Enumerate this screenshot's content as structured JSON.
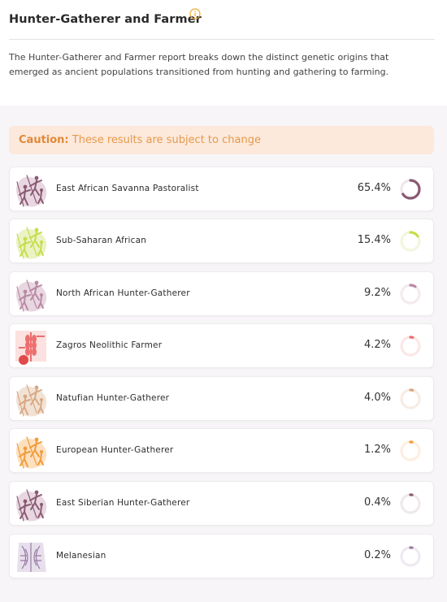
{
  "header": {
    "title": "Hunter-Gatherer and Farmer",
    "description": "The Hunter-Gatherer and Farmer report breaks down the distinct genetic origins that emerged as ancient populations transitioned from hunting and gathering to farming."
  },
  "caution": {
    "label": "Caution:",
    "text": " These results are subject to change"
  },
  "results": [
    {
      "name": "East African Savanna Pastoralist",
      "percent": "65.4%",
      "value": 65.4,
      "color": "#8a5a73",
      "track": "#efe6ec",
      "icon": "hunter-figures-icon",
      "bg": "#e8d7e0"
    },
    {
      "name": "Sub-Saharan African",
      "percent": "15.4%",
      "value": 15.4,
      "color": "#c8dc4a",
      "track": "#f1f6dd",
      "icon": "hunter-figures-icon",
      "bg": "#e9f3c4"
    },
    {
      "name": "North African Hunter-Gatherer",
      "percent": "9.2%",
      "value": 9.2,
      "color": "#b98aa4",
      "track": "#f3ebef",
      "icon": "hunter-figures-icon",
      "bg": "#e8d7e0"
    },
    {
      "name": "Zagros Neolithic Farmer",
      "percent": "4.2%",
      "value": 4.2,
      "color": "#ec6f6f",
      "track": "#fae7e6",
      "icon": "wheat-icon",
      "bg": "#fbe1df"
    },
    {
      "name": "Natufian Hunter-Gatherer",
      "percent": "4.0%",
      "value": 4.0,
      "color": "#d9a883",
      "track": "#f7ece3",
      "icon": "hunter-figures-icon",
      "bg": "#f1e2d4"
    },
    {
      "name": "European Hunter-Gatherer",
      "percent": "1.2%",
      "value": 1.2,
      "color": "#f29c3a",
      "track": "#fcefe0",
      "icon": "hunter-figures-icon",
      "bg": "#fde0bf"
    },
    {
      "name": "East Siberian Hunter-Gatherer",
      "percent": "0.4%",
      "value": 0.4,
      "color": "#8a5a73",
      "track": "#efe9ec",
      "icon": "hunter-figures-icon",
      "bg": "#e8d7e0"
    },
    {
      "name": "Melanesian",
      "percent": "0.2%",
      "value": 0.2,
      "color": "#9a7aa6",
      "track": "#efe9f2",
      "icon": "carved-pattern-icon",
      "bg": "#e7e0ec"
    }
  ]
}
